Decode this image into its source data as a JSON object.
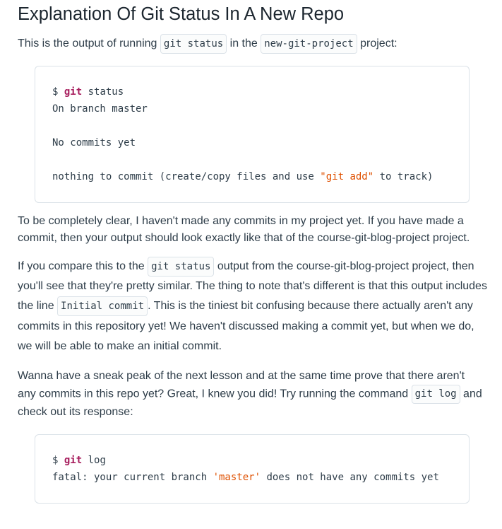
{
  "title": "Explanation Of Git Status In A New Repo",
  "intro": {
    "before": "This is the output of running ",
    "code1": "git status",
    "middle": " in the ",
    "code2": "new-git-project",
    "after": " project:"
  },
  "code_block_1": {
    "prompt": "$ ",
    "git_keyword": "git",
    "command_rest": " status",
    "line_branch": "On branch master",
    "line_no_commits": "No commits yet",
    "line_nothing_before": "nothing to commit (create/copy files and use ",
    "line_nothing_string": "\"git add\"",
    "line_nothing_after": " to track)"
  },
  "paragraph_1": {
    "text": "To be completely clear, I haven't made any commits in my project yet. If you have made a commit, then your output should look exactly like that of the course-git-blog-project project."
  },
  "paragraph_2": {
    "before": "If you compare this to the ",
    "code1": "git status",
    "middle": " output from the course-git-blog-project project, then you'll see that they're pretty similar. The thing to note that's different is that this output includes the line ",
    "code2": "Initial commit",
    "after": ". This is the tiniest bit confusing because there actually aren't any commits in this repository yet! We haven't discussed making a commit yet, but when we do, we will be able to make an initial commit."
  },
  "paragraph_3": {
    "before": "Wanna have a sneak peak of the next lesson and at the same time prove that there aren't any commits in this repo yet? Great, I knew you did! Try running the command ",
    "code1": "git log",
    "after": " and check out its response:"
  },
  "code_block_2": {
    "prompt": "$ ",
    "git_keyword": "git",
    "command_rest": " log",
    "line_fatal_before": "fatal: your current branch ",
    "line_fatal_string": "'master'",
    "line_fatal_after": " does not have any commits yet"
  },
  "colors": {
    "text": "#2e3d49",
    "keyword": "#a71d5d",
    "string": "#df5000",
    "border": "#dbe2e8"
  }
}
